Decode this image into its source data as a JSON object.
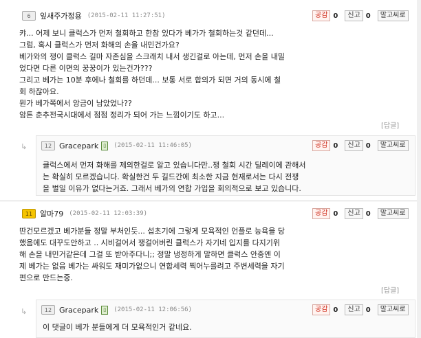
{
  "labels": {
    "like": "공감",
    "report": "신고",
    "block": "말고씨로",
    "reply": "[답글]",
    "reply_arrow": "↳"
  },
  "comments": [
    {
      "level": "6",
      "nick": "잎새주가정용",
      "date": "(2015-02-11 11:27:51)",
      "likes": "0",
      "reports": "0",
      "body": "캬... 어제 보니 클럭스가 먼저 철회하고 한참 있다가 베가가 철회하는것 같던데...\n그럼, 혹시 클럭스가 먼저 화해의 손을 내민건가요?\n베가와의 쟁이 클럭스 길마 자존심을 스크래치 내서 생긴걸로 아는데, 먼저 손을 내밀\n었다면 다른 이면의 꿍꿍이가 있는건가???\n그리고 베가는 10분 후에나 철회를 하던데... 보통 서로 합의가 되면 거의 동시에 철\n회 하잖아요.\n뭔가 베가쪽에서 앙금이 남았었나??\n암튼 춘추전국시대에서 점점 정리가 되어 가는 느낌이기도 하고...",
      "reply": {
        "level": "12",
        "nick": "Gracepark",
        "date": "(2015-02-11 11:46:05)",
        "likes": "0",
        "reports": "0",
        "body": "클럭스에서 먼저 화해를 제의한걸로 알고 있습니다만..쟁 철회 시간 딜레이에 관해서\n는 확실히 모르겠습니다. 확실한건 두 길드간에 최소한 지금 현재로서는 다시 전쟁\n을 벌일 이유가 없다는거죠. 그래서 베가의 연합 가입을 회의적으로 보고 있습니다."
      }
    },
    {
      "level": "11",
      "nick": "알마79",
      "date": "(2015-02-11 12:03:39)",
      "likes": "0",
      "reports": "0",
      "body": "딴건모르겠고 베가분들 정말 부처인듯... 섭초기에 그렇게 모욕적인 언플로 능욕을 당\n했음에도 대꾸도안하고 .. 시비걸어서 쟁걸어버린 클럭스가 자기네 입지를 다지기위\n해 손을 내민거같은데 그걸 또 받아주다니;; 정말 냉정하게 말하면 클럭스 안중엔 이\n제 베가는 없음 베가는 싸워도 재미가없으니 연합세력 찍어누를려고 주변세력을 자기\n편으로 만드는중.",
      "reply": {
        "level": "12",
        "nick": "Gracepark",
        "date": "(2015-02-11 12:06:56)",
        "likes": "0",
        "reports": "0",
        "body": "이 댓글이 베가 분들에게 더 모욕적인거 같네요."
      }
    }
  ]
}
